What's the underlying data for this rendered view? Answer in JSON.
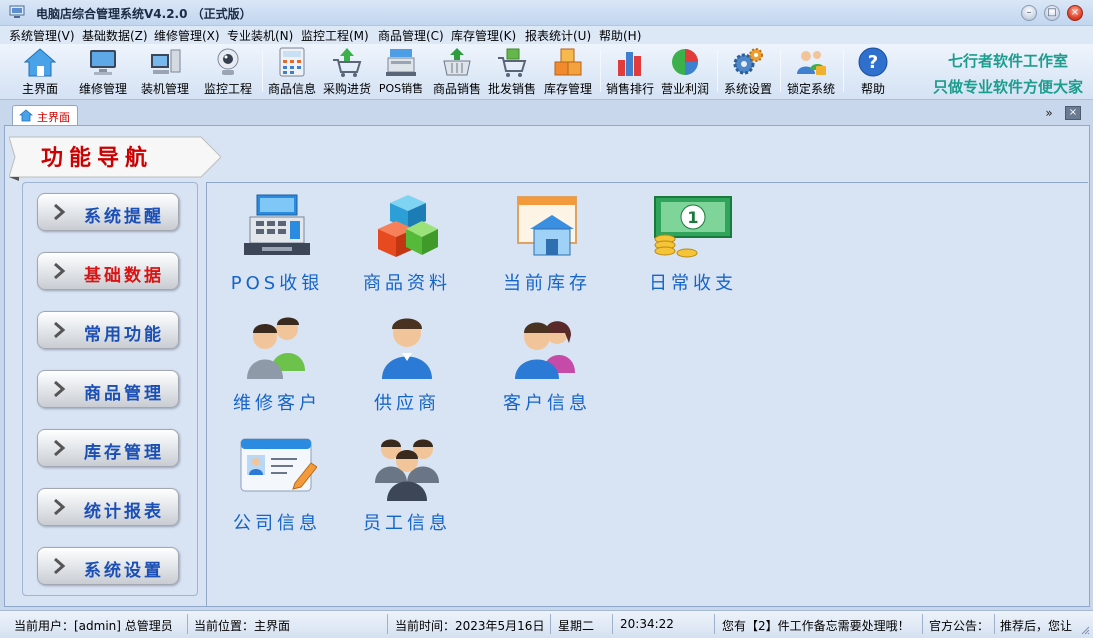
{
  "window": {
    "title": "电脑店综合管理系统V4.2.0 （正式版）",
    "controls": [
      "minimize",
      "maximize",
      "close"
    ]
  },
  "menu": [
    "系统管理(V)",
    "基础数据(Z)",
    "维修管理(X)",
    "专业装机(N)",
    "监控工程(M)",
    "商品管理(C)",
    "库存管理(K)",
    "报表统计(U)",
    "帮助(H)"
  ],
  "toolbar": {
    "items": [
      {
        "label": "主界面",
        "icon": "home-icon"
      },
      {
        "label": "维修管理",
        "icon": "monitor-icon"
      },
      {
        "label": "装机管理",
        "icon": "computer-icon"
      },
      {
        "label": "监控工程",
        "icon": "webcam-icon"
      },
      {
        "label": "商品信息",
        "icon": "calculator-icon"
      },
      {
        "label": "采购进货",
        "icon": "cart-in-icon"
      },
      {
        "label": "POS销售",
        "icon": "cash-register-icon"
      },
      {
        "label": "商品销售",
        "icon": "basket-icon"
      },
      {
        "label": "批发销售",
        "icon": "cart-out-icon"
      },
      {
        "label": "库存管理",
        "icon": "boxes-icon"
      },
      {
        "label": "销售排行",
        "icon": "bar-chart-icon"
      },
      {
        "label": "营业利润",
        "icon": "pie-chart-icon"
      },
      {
        "label": "系统设置",
        "icon": "gears-icon"
      },
      {
        "label": "锁定系统",
        "icon": "users-lock-icon"
      },
      {
        "label": "帮助",
        "icon": "help-icon"
      }
    ],
    "brand_line1": "七行者软件工作室",
    "brand_line2": "只做专业软件方便大家"
  },
  "tabs": {
    "active_label": "主界面"
  },
  "sidebar": {
    "banner": "功能导航",
    "items": [
      {
        "label": "系统提醒",
        "active": false
      },
      {
        "label": "基础数据",
        "active": true
      },
      {
        "label": "常用功能",
        "active": false
      },
      {
        "label": "商品管理",
        "active": false
      },
      {
        "label": "库存管理",
        "active": false
      },
      {
        "label": "统计报表",
        "active": false
      },
      {
        "label": "系统设置",
        "active": false
      }
    ]
  },
  "functions": [
    {
      "label": "POS收银",
      "icon": "cash-register-icon"
    },
    {
      "label": "商品资料",
      "icon": "cubes-icon"
    },
    {
      "label": "当前库存",
      "icon": "warehouse-icon"
    },
    {
      "label": "日常收支",
      "icon": "money-icon"
    },
    {
      "label": "维修客户",
      "icon": "two-users-icon"
    },
    {
      "label": "供应商",
      "icon": "user-icon"
    },
    {
      "label": "客户信息",
      "icon": "customers-icon"
    },
    {
      "label": "公司信息",
      "icon": "id-card-icon"
    },
    {
      "label": "员工信息",
      "icon": "group-icon"
    }
  ],
  "status": {
    "user": "当前用户：[admin] 总管理员",
    "location": "当前位置：主界面",
    "date": "当前时间：2023年5月16日",
    "weekday": "星期二",
    "time": "20:34:22",
    "memo": "您有【2】件工作备忘需要处理哦！",
    "notice_label": "官方公告：",
    "notice": "推荐后，您让"
  }
}
